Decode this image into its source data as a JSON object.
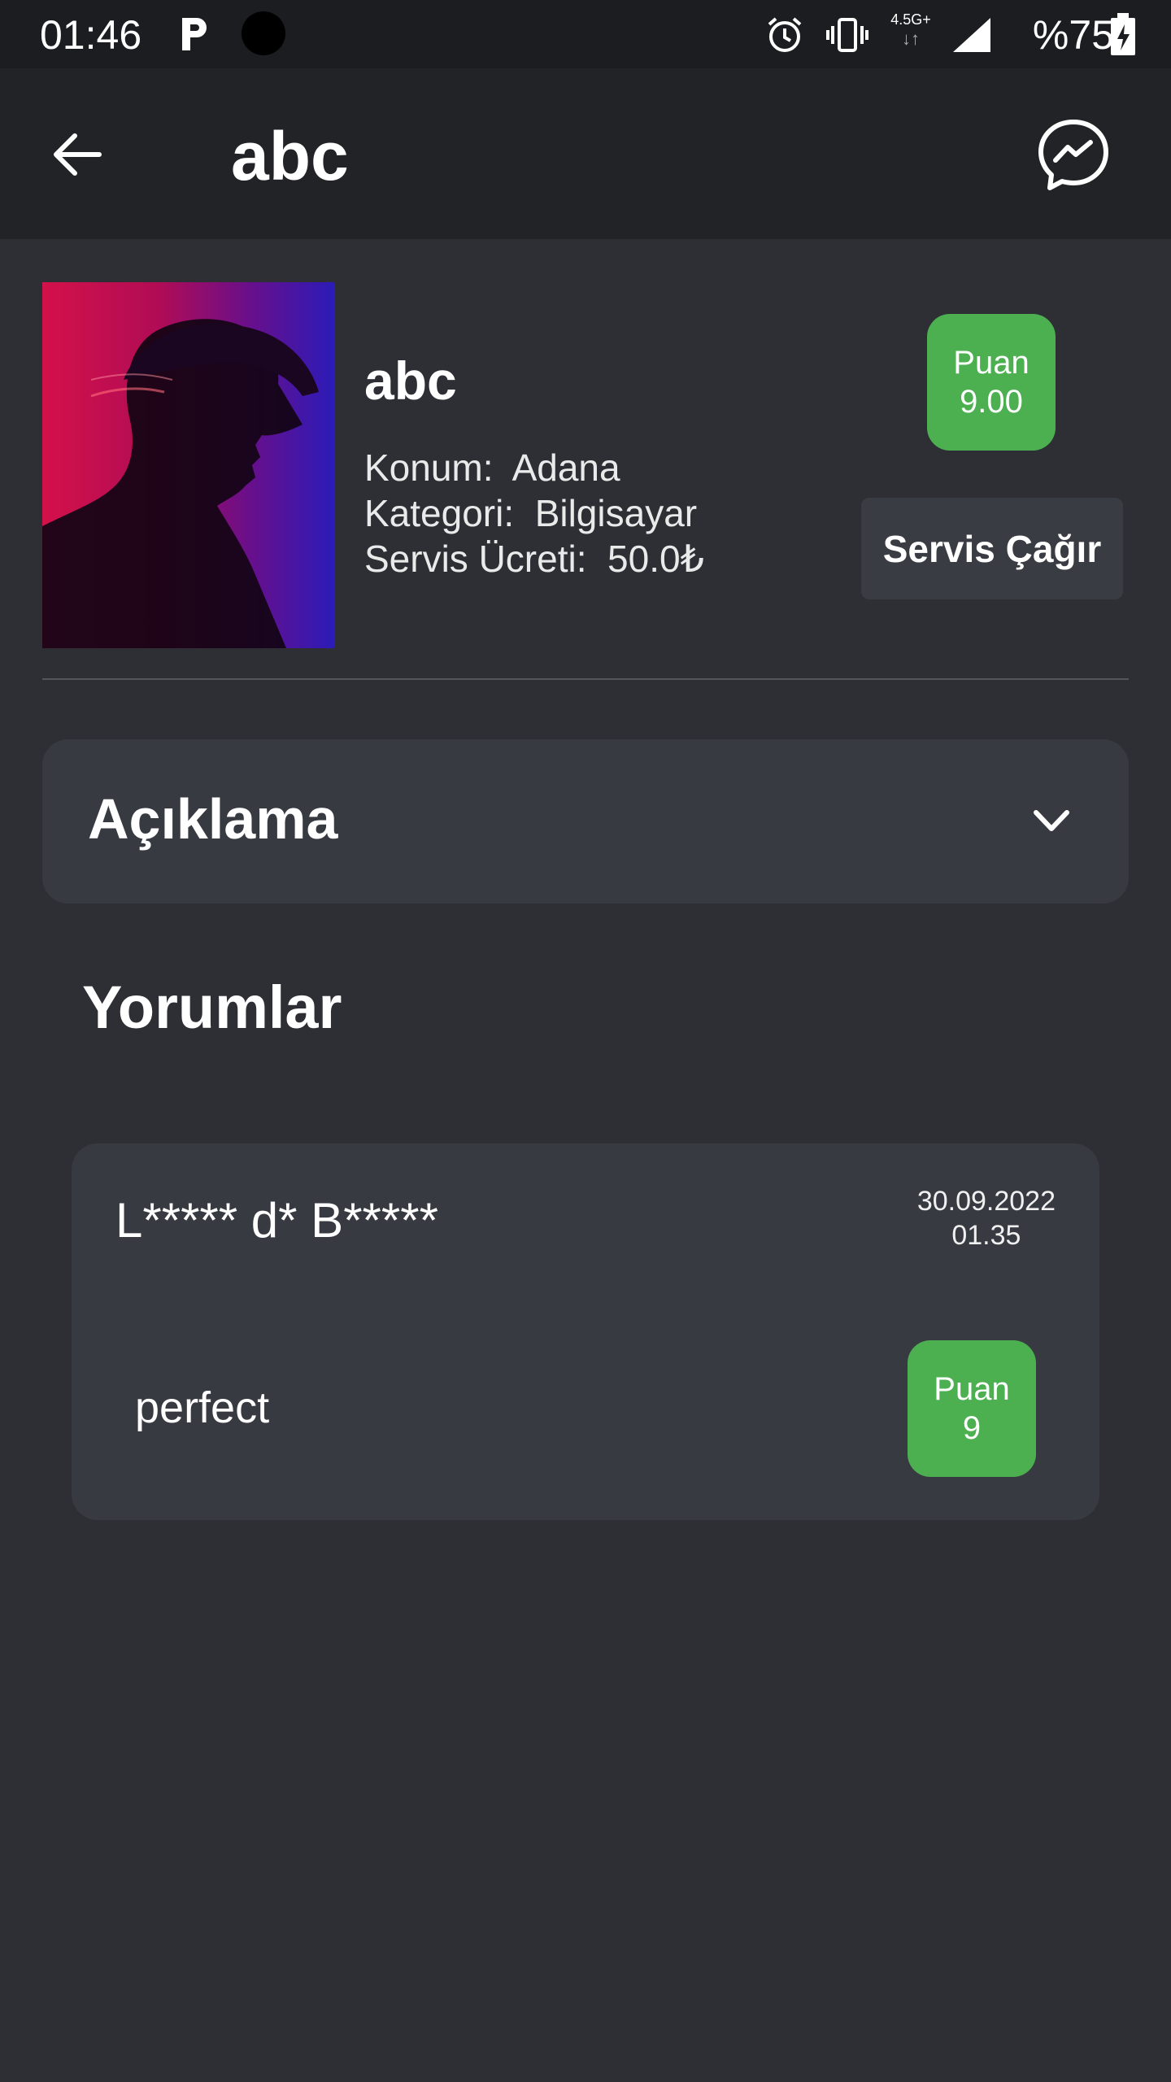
{
  "status_bar": {
    "time": "01:46",
    "network_label": "4.5G+",
    "battery": "%75",
    "icons": [
      "parking-icon",
      "alarm-icon",
      "vibrate-icon",
      "network-icon",
      "signal-icon",
      "battery-charging-icon"
    ]
  },
  "app_bar": {
    "title": "abc",
    "back_icon": "back-arrow-icon",
    "chat_icon": "messenger-icon"
  },
  "profile": {
    "name": "abc",
    "location_label": "Konum:",
    "location_value": "Adana",
    "category_label": "Kategori:",
    "category_value": "Bilgisayar",
    "fee_label": "Servis Ücreti:",
    "fee_value": "50.0₺",
    "score_label": "Puan",
    "score_value": "9.00",
    "call_button": "Servis Çağır"
  },
  "description": {
    "title": "Açıklama",
    "icon": "chevron-down-icon"
  },
  "comments_section": {
    "title": "Yorumlar",
    "items": [
      {
        "user": "L***** d* B*****",
        "date": "30.09.2022",
        "time": "01.35",
        "text": "perfect",
        "score_label": "Puan",
        "score_value": "9"
      }
    ]
  },
  "colors": {
    "background": "#2e2f35",
    "app_bar": "#222327",
    "card": "#383a42",
    "accent_green": "#4caf50"
  }
}
